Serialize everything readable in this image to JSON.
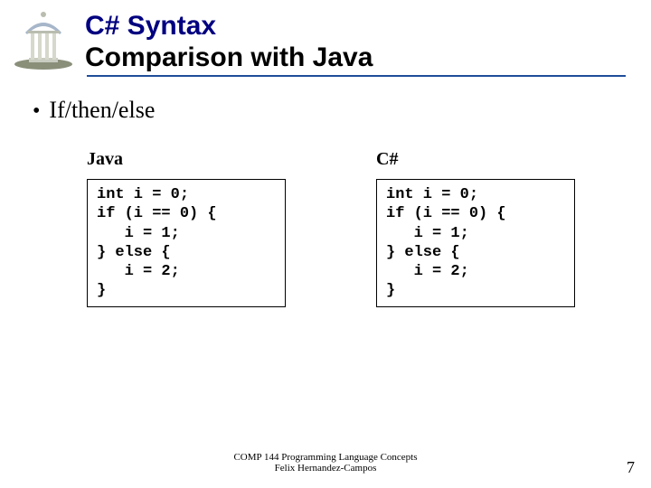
{
  "header": {
    "title": "C# Syntax",
    "subtitle": "Comparison with Java"
  },
  "bullet": "• ",
  "topic": "If/then/else",
  "columns": {
    "left": {
      "label": "Java",
      "code": "int i = 0;\nif (i == 0) {\n   i = 1;\n} else {\n   i = 2;\n}"
    },
    "right": {
      "label": "C#",
      "code": "int i = 0;\nif (i == 0) {\n   i = 1;\n} else {\n   i = 2;\n}"
    }
  },
  "footer": {
    "line1": "COMP 144 Programming Language Concepts",
    "line2": "Felix Hernandez-Campos"
  },
  "page": "7"
}
